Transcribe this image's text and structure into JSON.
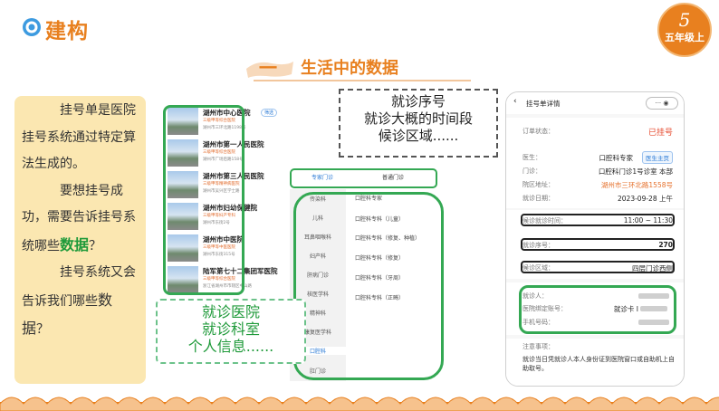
{
  "header": {
    "title": "建构",
    "grade_number": "5",
    "grade_label": "五年级上"
  },
  "section": {
    "number": "一",
    "title": "生活中的数据"
  },
  "left_card": {
    "p1": "挂号单是医院挂号系统通过特定算法生成的。",
    "p2a": "要想挂号成功，需要告诉挂号系统哪些",
    "p2b": "数据",
    "p2c": "？",
    "p3a": "挂号系统又会告诉我们哪些",
    "p3b": "数据",
    "p3c": "？"
  },
  "hospital_list": {
    "filter": "筛选",
    "items": [
      {
        "name": "湖州市中心医院",
        "level": "三级甲等综合医院",
        "addr": "湖州市三环北路1198号"
      },
      {
        "name": "湖州市第一人民医院",
        "level": "三级甲等综合医院",
        "addr": "湖州市广场后路158号"
      },
      {
        "name": "湖州市第三人民医院",
        "level": "三级甲等精神病医院",
        "addr": "湖州市吴兴区学士路"
      },
      {
        "name": "湖州市妇幼保健院",
        "level": "三级甲等妇产专科",
        "addr": "湖州市东街2号"
      },
      {
        "name": "湖州市中医院",
        "level": "三级甲等中医医院",
        "addr": "湖州市东街315号"
      },
      {
        "name": "陆军第七十二集团军医院",
        "level": "三级甲等综合医院",
        "addr": "浙江省湖州市市辖区中山路"
      }
    ]
  },
  "label1": {
    "line1": "就诊医院",
    "line2": "就诊科室",
    "line3": "个人信息......"
  },
  "label2": {
    "line1": "就诊序号",
    "line2": "就诊大概的时间段",
    "line3": "候诊区域......"
  },
  "dept": {
    "tab_expert": "专家门诊",
    "tab_normal": "普通门诊",
    "departments": [
      "传染科",
      "儿科",
      "耳鼻咽喉科",
      "妇产科",
      "肝病门诊",
      "核医学科",
      "精神科",
      "康复医学科",
      "口腔科",
      "肛门诊"
    ],
    "subs": [
      "口腔科专家",
      "口腔科专科（儿童）",
      "口腔科专科（修复、种植）",
      "口腔科专科（修复）",
      "口腔科专科（牙周）",
      "口腔科专科（正畸）"
    ]
  },
  "detail": {
    "page_title": "挂号单详情",
    "caps": "··· ◉",
    "status_label": "订单状态：",
    "status_value": "已挂号",
    "doctor_label": "医生：",
    "doctor_value": "口腔科专家",
    "doctor_btn": "医生主页",
    "clinic_label": "门诊：",
    "clinic_value": "口腔科门诊1号诊室 本部",
    "address_label": "院区地址：",
    "address_value": "湖州市三环北路1558号",
    "date_label": "就诊日期：",
    "date_value": "2023-09-28 上午",
    "time_label": "候诊就诊时间：",
    "time_value": "11:00 ~ 11:30",
    "seq_label": "就诊序号：",
    "seq_value": "270",
    "area_label": "候诊区域：",
    "area_value": "四层门诊西侧",
    "patient_label": "就诊人：",
    "card_label": "医院绑定账号：",
    "card_value": "就诊卡 I",
    "phone_label": "手机号码：",
    "notes_title": "注意事项：",
    "notes_text": "就诊当日凭就诊人本人身份证到医院窗口或自助机上自助取号。"
  },
  "colors": {
    "accent": "#e8801f",
    "highlight_green": "#34a853",
    "card_bg": "#fbe7b1",
    "status_red": "#e64a2e"
  }
}
